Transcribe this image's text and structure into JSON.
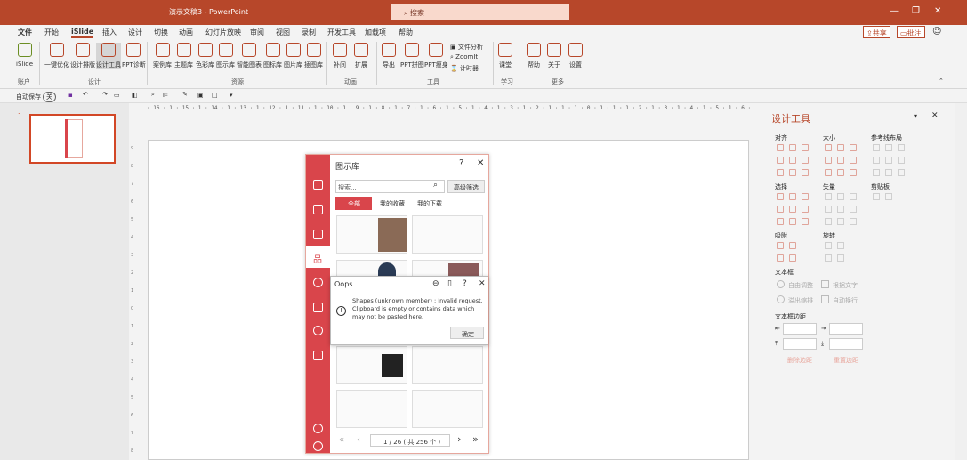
{
  "title": "演示文稿3  -  PowerPoint",
  "search": "搜索",
  "tabs": [
    "文件",
    "开始",
    "iSlide",
    "插入",
    "设计",
    "切换",
    "动画",
    "幻灯片放映",
    "审阅",
    "视图",
    "录制",
    "开发工具",
    "加载项",
    "帮助"
  ],
  "share": "共享",
  "comment": "批注",
  "ribbon": {
    "islide": "iSlide",
    "yijian": "一键优化",
    "sheji": "设计排版",
    "gongju": "设计工具",
    "zhenduan": "PPT诊断",
    "anli": "案例库",
    "zhuti": "主题库",
    "secai": "色彩库",
    "tushi": "图示库",
    "zhineng": "智能图表",
    "tubiao": "图标库",
    "tupian": "图片库",
    "chatu": "插图库",
    "buchong": "补间",
    "kuozhan": "扩展",
    "daochu": "导出",
    "pinjie": "PPT拼图",
    "shouzhen": "PPT瘦身",
    "wenjian": "文件分析",
    "zoomit": "ZoomIt",
    "jishi": "计时器",
    "ketang": "课堂",
    "bangzhu": "帮助",
    "guanyu": "关于",
    "shezhi": "设置",
    "groups": [
      "账户",
      "设计",
      "资源",
      "动画",
      "工具",
      "学习",
      "更多"
    ]
  },
  "qat": {
    "autosave": "自动保存",
    "toggle": "关"
  },
  "slide_num": "1",
  "ruler": "· 16 · 1 · 15 · 1 · 14 · 1 · 13 · 1 · 12 · 1 · 11 · 1 · 10 · 1 · 9 · 1 · 8 · 1 · 7 · 1 · 6 · 1 · 5 · 1 · 4 · 1 · 3 · 1 · 2 · 1 · 1 · 1 · 0 · 1 · 1 · 1 · 2 · 1 · 3 · 1 · 4 · 1 · 5 · 1 · 6 · 1 · 7 · 1 · 8 · 1 · 9 · 1 · 10 · 1 · 11 · 1 · 12 · 1 · 13 · 1 · 14 · 1 · 15 · 1 · 16 ·",
  "vruler": [
    "9",
    "8",
    "7",
    "6",
    "5",
    "4",
    "3",
    "2",
    "1",
    "0",
    "1",
    "2",
    "3",
    "4",
    "5",
    "6",
    "7",
    "8"
  ],
  "lib": {
    "title": "图示库",
    "search_placeholder": "搜索...",
    "advanced": "高级筛选",
    "tabs": [
      "全部",
      "我的收藏",
      "我的下载"
    ],
    "pager": "1 / 26 ( 共 256 个 )"
  },
  "oops": {
    "title": "Oops",
    "message": "Shapes (unknown member) : Invalid request. Clipboard is empty or contains data which may not be pasted here.",
    "ok": "确定"
  },
  "design_panel": {
    "title": "设计工具",
    "align": "对齐",
    "size": "大小",
    "ref": "参考线布局",
    "select": "选择",
    "vector": "矢量",
    "clipboard": "剪贴板",
    "snap": "吸附",
    "rotate": "旋转",
    "textbox": "文本框",
    "autofit": "自由调整",
    "shrink": "溢出缩排",
    "wrap_text": "根据文字",
    "autowrap": "自动换行",
    "margin": "文本框边距",
    "sync_margin": "删除边距",
    "resize_margin": "重置边距"
  },
  "colors": {
    "accent": "#b7472a",
    "islide_red": "#d9454b"
  }
}
